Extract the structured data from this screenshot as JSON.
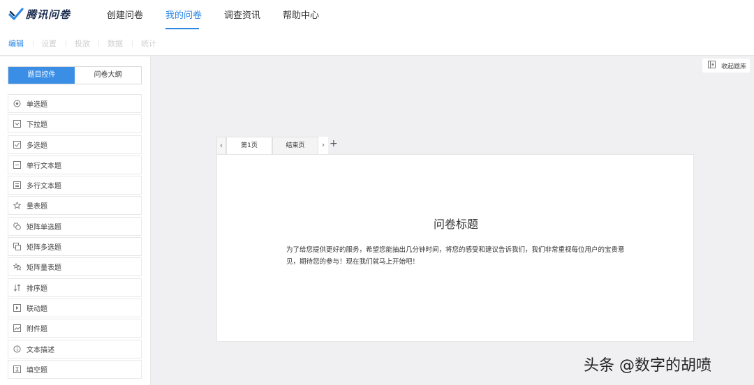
{
  "app": {
    "logo_text": "腾讯问卷",
    "brand_color": "#2e89e6"
  },
  "nav": {
    "items": [
      {
        "label": "创建问卷",
        "active": false
      },
      {
        "label": "我的问卷",
        "active": true
      },
      {
        "label": "调查资讯",
        "active": false
      },
      {
        "label": "帮助中心",
        "active": false
      }
    ]
  },
  "subnav": {
    "items": [
      {
        "label": "编辑",
        "active": true
      },
      {
        "label": "设置",
        "active": false
      },
      {
        "label": "投放",
        "active": false
      },
      {
        "label": "数据",
        "active": false
      },
      {
        "label": "统计",
        "active": false
      }
    ]
  },
  "sidebar": {
    "tabs": [
      {
        "label": "题目控件",
        "active": true
      },
      {
        "label": "问卷大纲",
        "active": false
      }
    ],
    "question_types": [
      {
        "label": "单选题",
        "icon": "radio-icon"
      },
      {
        "label": "下拉题",
        "icon": "dropdown-icon"
      },
      {
        "label": "多选题",
        "icon": "checkbox-icon"
      },
      {
        "label": "单行文本题",
        "icon": "single-line-text-icon"
      },
      {
        "label": "多行文本题",
        "icon": "multi-line-text-icon"
      },
      {
        "label": "量表题",
        "icon": "star-icon"
      },
      {
        "label": "矩阵单选题",
        "icon": "matrix-radio-icon"
      },
      {
        "label": "矩阵多选题",
        "icon": "matrix-checkbox-icon"
      },
      {
        "label": "矩阵量表题",
        "icon": "matrix-star-icon"
      },
      {
        "label": "排序题",
        "icon": "sort-icon"
      },
      {
        "label": "联动题",
        "icon": "linkage-icon"
      },
      {
        "label": "附件题",
        "icon": "attachment-icon"
      },
      {
        "label": "文本描述",
        "icon": "info-icon"
      },
      {
        "label": "填空题",
        "icon": "fill-blank-icon"
      }
    ]
  },
  "collapse_button": {
    "label": "收起题库",
    "icon": "collapse-library-icon"
  },
  "pages": {
    "tabs": [
      {
        "label": "第1页",
        "active": true
      },
      {
        "label": "结束页",
        "active": false
      }
    ],
    "add_symbol": "+",
    "prev_symbol": "‹",
    "next_symbol": "›"
  },
  "survey": {
    "title": "问卷标题",
    "description": "为了给您提供更好的服务，希望您能抽出几分钟时间，将您的感受和建议告诉我们，我们非常重视每位用户的宝贵意见，期待您的参与！现在我们就马上开始吧！"
  },
  "watermark": {
    "text": "头条 @数字的胡喷"
  }
}
